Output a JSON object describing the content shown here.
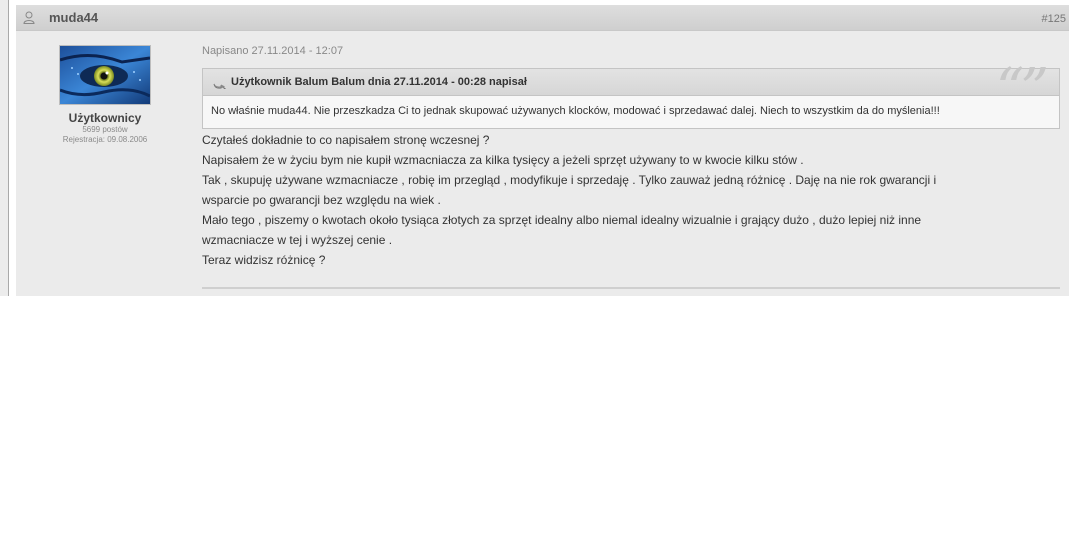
{
  "post": {
    "author": "muda44",
    "number": "#125",
    "posted_at": "Napisano 27.11.2014 - 12:07",
    "user": {
      "group": "Użytkownicy",
      "posts": "5699 postów",
      "registered": "Rejestracja: 09.08.2006"
    },
    "quote": {
      "header": "Użytkownik Balum Balum dnia 27.11.2014 - 00:28 napisał",
      "text": "No właśnie muda44. Nie przeszkadza Ci to jednak skupować używanych klocków, modować i sprzedawać dalej. Niech to wszystkim da do myślenia!!!"
    },
    "body_lines": [
      "Czytałeś dokładnie to co napisałem stronę wczesnej ?",
      "Napisałem że w życiu bym nie kupił wzmacniacza za kilka tysięcy a jeżeli sprzęt  używany to w kwocie kilku stów .",
      "Tak , skupuję używane wzmacniacze , robię im przegląd , modyfikuje i sprzedaję . Tylko zauważ jedną różnicę . Daję na nie rok gwarancji i",
      "wsparcie po gwarancji bez względu na wiek .",
      "Mało tego , piszemy o kwotach około tysiąca złotych za sprzęt idealny albo niemal idealny wizualnie i grający dużo , dużo lepiej niż inne",
      "wzmacniacze w tej i wyższej cenie .",
      "Teraz widzisz różnicę ?"
    ]
  },
  "icons": {
    "user": "user-icon",
    "avatar": "avatar-image",
    "quote": "quote-arrow-icon"
  }
}
